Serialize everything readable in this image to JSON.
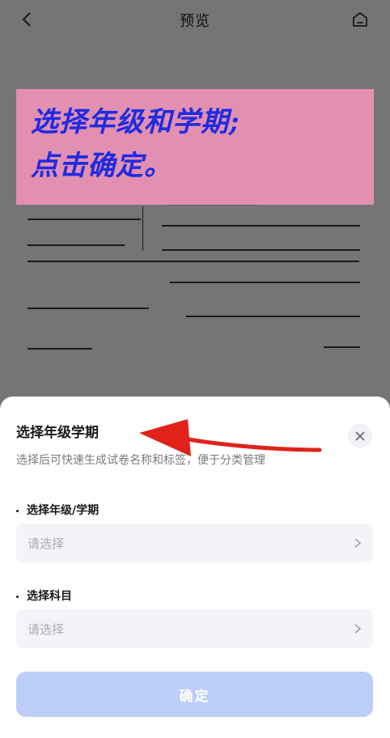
{
  "header": {
    "title": "预览",
    "back_icon": "chevron-left-icon",
    "home_icon": "home-icon"
  },
  "banner": {
    "line1": "选择年级和学期;",
    "line2": "点击确定。",
    "bg": "#e28fb2",
    "text_color": "#1f2be0"
  },
  "sheet": {
    "title": "选择年级学期",
    "subtitle": "选择后可快速生成试卷名称和标签，便于分类管理",
    "close_icon": "close-icon",
    "fields": [
      {
        "label": "选择年级/学期",
        "placeholder": "请选择",
        "chevron": "chevron-right-icon"
      },
      {
        "label": "选择科目",
        "placeholder": "请选择",
        "chevron": "chevron-right-icon"
      }
    ],
    "confirm_label": "确定",
    "confirm_color": "#bccdf6"
  },
  "annotation": {
    "arrow_color": "#e0221b"
  }
}
